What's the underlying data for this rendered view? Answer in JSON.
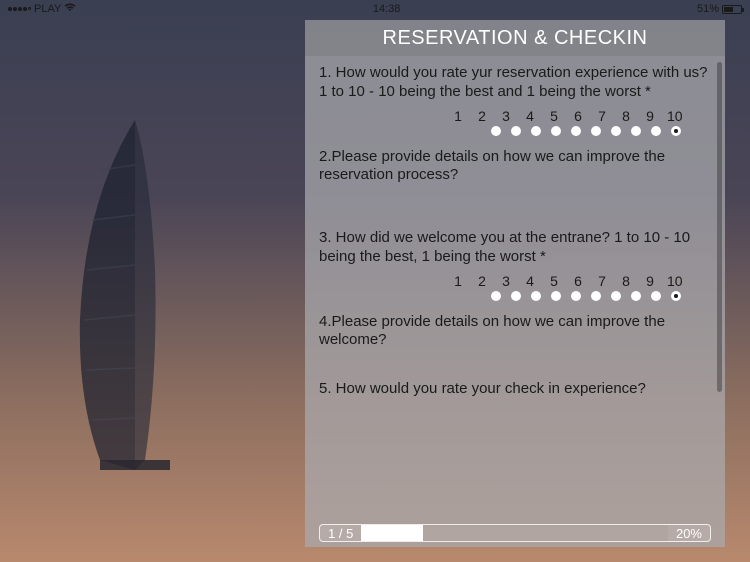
{
  "status": {
    "carrier": "PLAY",
    "time": "14:38",
    "battery_pct": "51%"
  },
  "panel": {
    "title": "RESERVATION & CHECKIN"
  },
  "questions": {
    "q1": {
      "text": "1. How would you rate yur reservation experience with us? 1 to 10 - 10 being the best and 1 being the worst *"
    },
    "q2": {
      "text": "2.Please provide details on how we can improve the reservation process?"
    },
    "q3": {
      "text": "3. How did we welcome you at the entrane? 1 to 10 - 10 being the best, 1 being the worst *"
    },
    "q4": {
      "text": "4.Please provide details on how we can improve the welcome?"
    },
    "q5": {
      "text": "5. How would you rate your check in experience?"
    }
  },
  "rating_scale": {
    "n1": "1",
    "n2": "2",
    "n3": "3",
    "n4": "4",
    "n5": "5",
    "n6": "6",
    "n7": "7",
    "n8": "8",
    "n9": "9",
    "n10": "10",
    "selected_q1": 10,
    "selected_q3": 10
  },
  "progress": {
    "label": "1 / 5",
    "pct": "20%",
    "fill_width": "20%"
  }
}
